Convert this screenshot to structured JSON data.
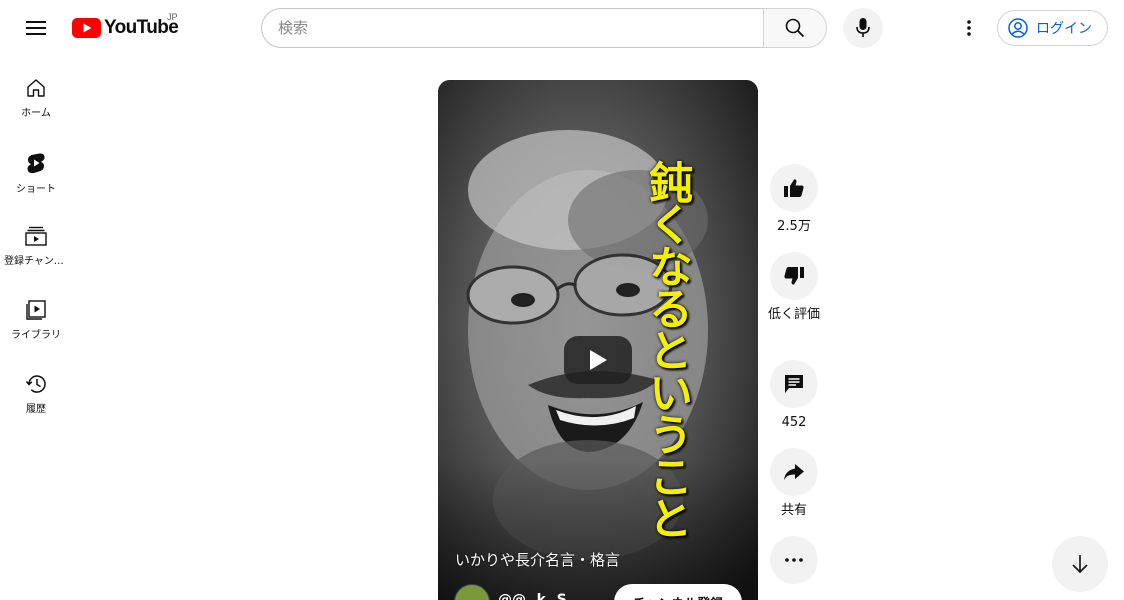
{
  "header": {
    "logo_text": "YouTube",
    "region": "JP",
    "search_placeholder": "検索",
    "login_label": "ログイン"
  },
  "sidebar": {
    "items": [
      {
        "label": "ホーム",
        "icon": "home-icon"
      },
      {
        "label": "ショート",
        "icon": "shorts-icon"
      },
      {
        "label": "登録チャンネル",
        "icon": "subscriptions-icon"
      },
      {
        "label": "ライブラリ",
        "icon": "library-icon"
      },
      {
        "label": "履歴",
        "icon": "history-icon"
      }
    ]
  },
  "short": {
    "overlay_text": "鈍くなるということ",
    "title": "いかりや長介名言・格言",
    "channel_name": "@@..k..S",
    "subscribe_label": "チャンネル登録"
  },
  "actions": {
    "like_count": "2.5万",
    "dislike_label": "低く評価",
    "comment_count": "452",
    "share_label": "共有"
  },
  "colors": {
    "brand_red": "#ff0000",
    "link_blue": "#065fd4",
    "overlay_yellow": "#f4f000"
  }
}
